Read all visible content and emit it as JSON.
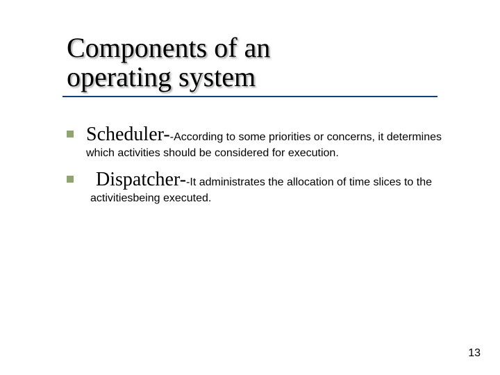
{
  "title_line1": "Components of an",
  "title_line2": "operating system",
  "bullets": [
    {
      "term": "Scheduler-",
      "desc": "-According to some priorities or concerns, it determines which activities should be considered for execution."
    },
    {
      "term": "Dispatcher-",
      "desc": "-It administrates the allocation of time slices to the activitiesbeing executed."
    }
  ],
  "page_number": "13"
}
